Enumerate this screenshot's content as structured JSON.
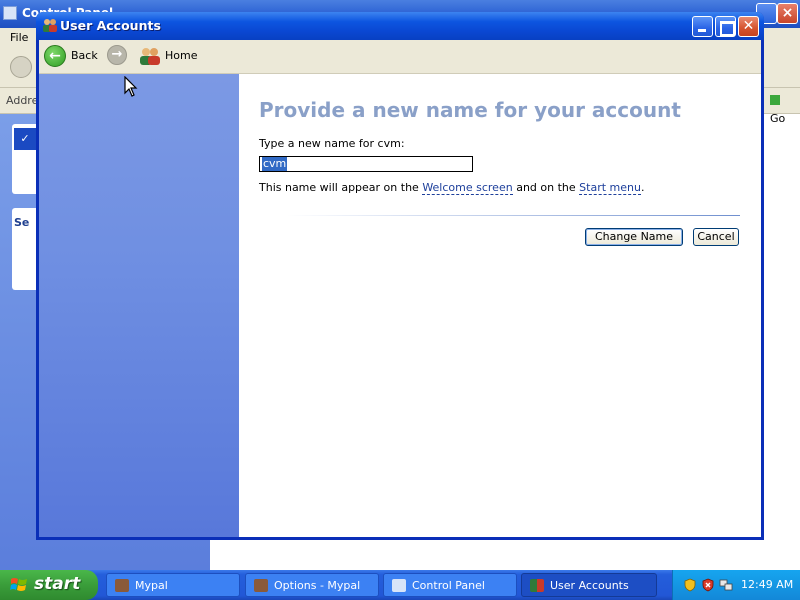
{
  "background_window": {
    "title": "Control Panel",
    "menu_file": "File",
    "address_label": "Address",
    "go_label": "Go",
    "side_panel_title": "Se"
  },
  "window": {
    "title": "User Accounts",
    "toolbar": {
      "back_label": "Back",
      "home_label": "Home"
    },
    "page_title": "Provide a new name for your account",
    "prompt_label": "Type a new name for cvm:",
    "name_input_value": "cvm",
    "info_text_before": "This name will appear on the",
    "link_welcome": "Welcome screen",
    "info_text_middle": "and on the",
    "link_start_menu": "Start menu",
    "info_text_after": ".",
    "buttons": {
      "change_name": "Change Name",
      "cancel": "Cancel"
    }
  },
  "taskbar": {
    "start_label": "start",
    "tasks": [
      {
        "label": "Mypal"
      },
      {
        "label": "Options - Mypal"
      },
      {
        "label": "Control Panel"
      },
      {
        "label": "User Accounts",
        "active": true
      }
    ],
    "clock": "12:49 AM"
  },
  "colors": {
    "title_bar": "#0a47d2",
    "sidebar": "#6f8fe2",
    "page_title": "#8aa0c8",
    "selection": "#316ac5",
    "taskbar": "#245edb",
    "start_button": "#3a9d3a"
  }
}
